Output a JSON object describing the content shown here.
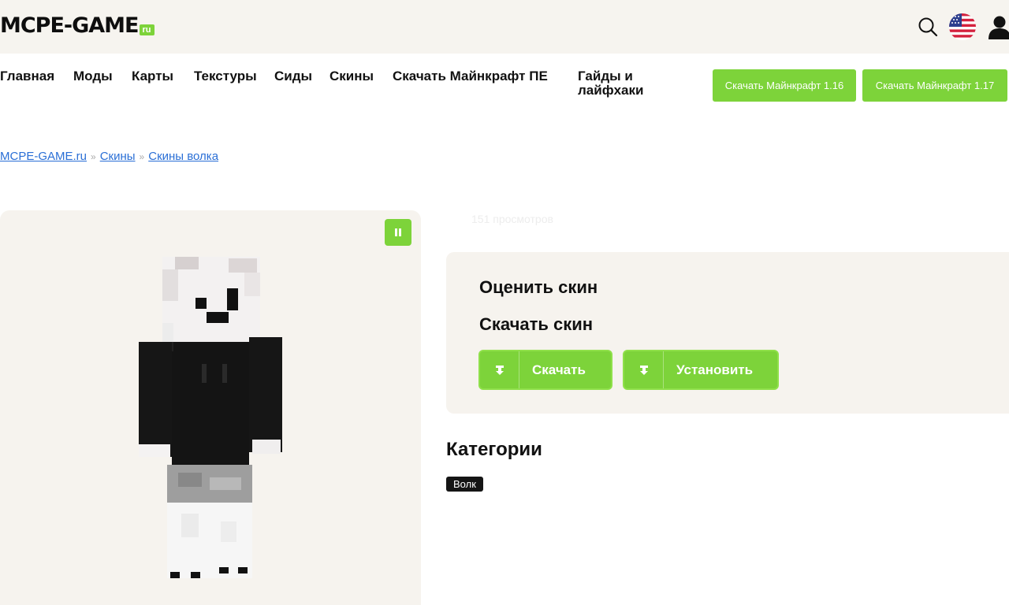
{
  "header": {
    "logo_text": "MCPE-GAME",
    "logo_tld": "ru",
    "icons": [
      "search-icon",
      "us-flag-icon",
      "user-icon"
    ]
  },
  "nav": {
    "items": [
      {
        "label": "Главная"
      },
      {
        "label": "Моды"
      },
      {
        "label": "Карты"
      },
      {
        "label": "Текстуры"
      },
      {
        "label": "Сиды"
      },
      {
        "label": "Скины"
      },
      {
        "label": "Скачать Майнкрафт ПЕ"
      },
      {
        "label": "Гайды и лайфхаки"
      }
    ],
    "download_buttons": [
      {
        "label": "Скачать Майнкрафт 1.16"
      },
      {
        "label": "Скачать Майнкрафт 1.17"
      }
    ]
  },
  "breadcrumb": {
    "items": [
      "MCPE-GAME.ru",
      "Скины",
      "Скины волка"
    ],
    "separator": "»"
  },
  "skin": {
    "views": "151 просмотров",
    "pause_icon": "pause-icon"
  },
  "actions": {
    "rate_title": "Оценить скин",
    "download_title": "Скачать скин",
    "download_label": "Скачать",
    "install_label": "Установить"
  },
  "categories": {
    "title": "Категории",
    "tags": [
      "Волк"
    ]
  },
  "colors": {
    "accent": "#7dd33a",
    "panel": "#f6f3ee",
    "link": "#2a6fd6"
  }
}
